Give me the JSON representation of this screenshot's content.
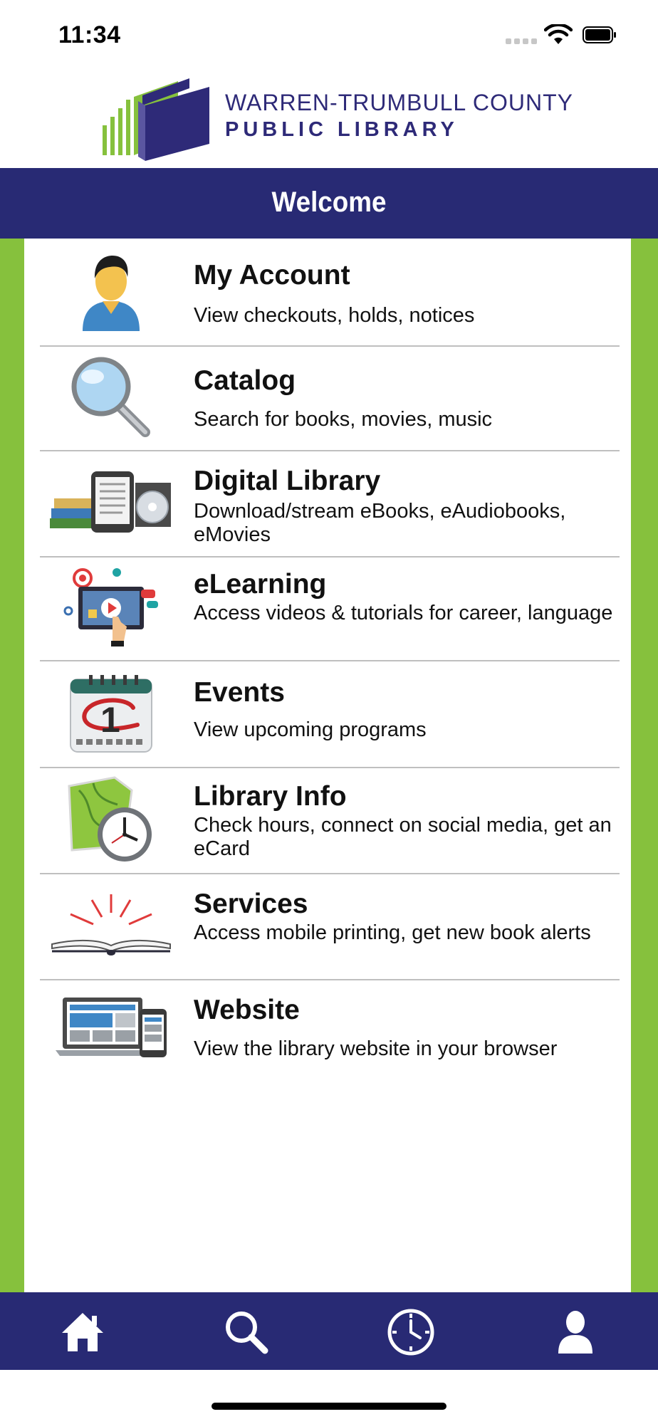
{
  "status_bar": {
    "time": "11:34"
  },
  "header": {
    "logo_line1": "WARREN-TRUMBULL COUNTY",
    "logo_line2": "PUBLIC LIBRARY",
    "welcome": "Welcome"
  },
  "menu": [
    {
      "title": "My Account",
      "desc": "View checkouts, holds, notices",
      "icon": "user-account-icon"
    },
    {
      "title": "Catalog",
      "desc": "Search for books, movies, music",
      "icon": "magnifying-glass-icon"
    },
    {
      "title": "Digital Library",
      "desc": "Download/stream eBooks, eAudiobooks, eMovies",
      "icon": "digital-library-icon"
    },
    {
      "title": "eLearning",
      "desc": "Access videos & tutorials for career, language",
      "icon": "elearning-icon"
    },
    {
      "title": "Events",
      "desc": "View upcoming programs",
      "icon": "calendar-icon"
    },
    {
      "title": "Library Info",
      "desc": "Check hours, connect on social media, get an eCard",
      "icon": "map-clock-icon"
    },
    {
      "title": "Services",
      "desc": "Access mobile printing, get new book alerts",
      "icon": "open-book-icon"
    },
    {
      "title": "Website",
      "desc": "View the library website in your browser",
      "icon": "devices-icon"
    }
  ],
  "tabbar": [
    "home-icon",
    "search-icon",
    "clock-icon",
    "profile-icon"
  ],
  "colors": {
    "navy": "#282a74",
    "green": "#86c13d"
  }
}
